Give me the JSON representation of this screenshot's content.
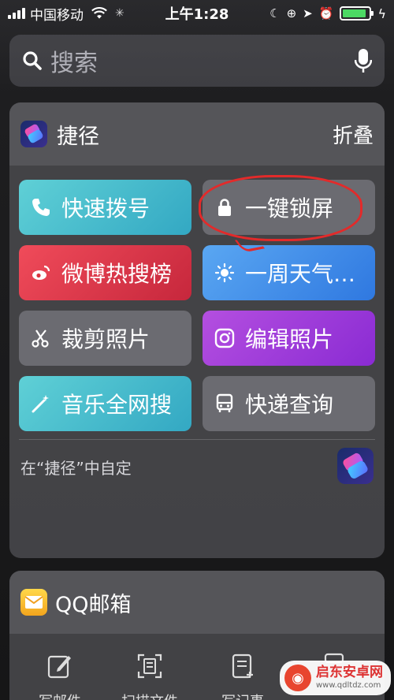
{
  "status_bar": {
    "carrier": "中国移动",
    "time": "上午1:28",
    "battery_level": 0.9
  },
  "search": {
    "placeholder": "搜索",
    "icon": "search-icon",
    "mic_icon": "microphone-icon"
  },
  "shortcuts_widget": {
    "title": "捷径",
    "collapse_label": "折叠",
    "tiles": [
      {
        "label": "快速拨号",
        "icon": "phone-icon",
        "color": "#46bfd0"
      },
      {
        "label": "一键锁屏",
        "icon": "lock-icon",
        "color": "#6e6e74"
      },
      {
        "label": "微博热搜榜",
        "icon": "weibo-icon",
        "color": "#e03b4d"
      },
      {
        "label": "一周天气…",
        "icon": "sun-icon",
        "color": "#4590ea"
      },
      {
        "label": "裁剪照片",
        "icon": "scissors-icon",
        "color": "#6e6e74"
      },
      {
        "label": "编辑照片",
        "icon": "instagram-icon",
        "color": "#a03ddb"
      },
      {
        "label": "音乐全网搜",
        "icon": "magic-wand-icon",
        "color": "#46bfd0"
      },
      {
        "label": "快递查询",
        "icon": "bus-icon",
        "color": "#6e6e74"
      }
    ],
    "customize_label": "在“捷径”中自定"
  },
  "mail_widget": {
    "title": "QQ邮箱",
    "actions": [
      {
        "label": "写邮件",
        "icon": "compose-icon"
      },
      {
        "label": "扫描文件",
        "icon": "scan-icon"
      },
      {
        "label": "写记事",
        "icon": "note-icon"
      },
      {
        "label": "",
        "icon": "more-icon"
      }
    ]
  },
  "watermark": {
    "title": "启东安卓网",
    "url": "www.qdltdz.com"
  }
}
